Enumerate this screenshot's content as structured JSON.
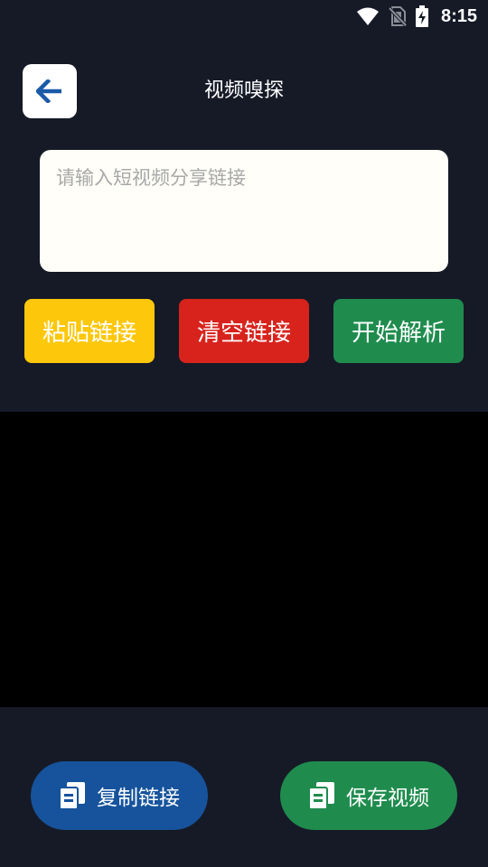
{
  "status_bar": {
    "time": "8:15",
    "icons": [
      "wifi-icon",
      "no-sim-icon",
      "battery-charging-icon"
    ]
  },
  "header": {
    "title": "视频嗅探",
    "back_icon": "arrow-left-icon"
  },
  "input": {
    "value": "",
    "placeholder": "请输入短视频分享链接"
  },
  "actions": {
    "paste_label": "粘贴链接",
    "clear_label": "清空链接",
    "parse_label": "开始解析"
  },
  "bottom": {
    "copy_label": "复制链接",
    "save_label": "保存视频",
    "icon": "copy-document-icon"
  },
  "colors": {
    "background": "#161a27",
    "paste": "#fdc70b",
    "clear": "#d8231d",
    "parse": "#1f8c4e",
    "copy": "#16539c",
    "save": "#1f8c4e",
    "back_arrow": "#1a5aa8",
    "video_bg": "#000000"
  }
}
